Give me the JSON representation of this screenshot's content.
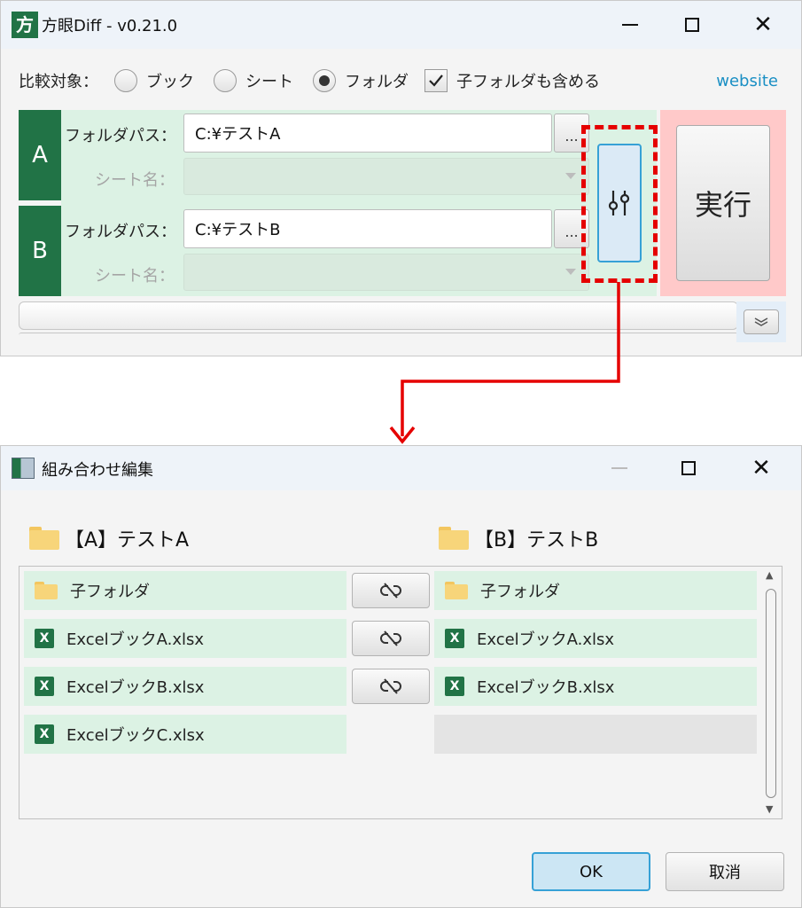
{
  "main_window": {
    "app_icon_glyph": "方",
    "title": "方眼Diff  -  v0.21.0",
    "controls": {
      "minimize": "minimize-icon",
      "maximize": "maximize-icon",
      "close": "close-icon"
    },
    "compare_label": "比較対象：",
    "options": [
      {
        "label": "ブック",
        "selected": false
      },
      {
        "label": "シート",
        "selected": false
      },
      {
        "label": "フォルダ",
        "selected": true
      }
    ],
    "include_subfolders": {
      "label": "子フォルダも含める",
      "checked": true
    },
    "website_link": "website",
    "side_a": {
      "label": "A",
      "folder_label": "フォルダパス：",
      "folder_value": "C:¥テストA",
      "sheet_label": "シート名："
    },
    "side_b": {
      "label": "B",
      "folder_label": "フォルダパス：",
      "folder_value": "C:¥テストB",
      "sheet_label": "シート名："
    },
    "browse_label": "...",
    "run_button": "実行"
  },
  "combination_dialog": {
    "title": "組み合わせ編集",
    "header_a": "【A】テストA",
    "header_b": "【B】テストB",
    "rows_a": [
      {
        "icon": "folder-icon",
        "name": "子フォルダ"
      },
      {
        "icon": "excel-icon",
        "name": "ExcelブックA.xlsx"
      },
      {
        "icon": "excel-icon",
        "name": "ExcelブックB.xlsx"
      },
      {
        "icon": "excel-icon",
        "name": "ExcelブックC.xlsx"
      }
    ],
    "rows_b": [
      {
        "icon": "folder-icon",
        "name": "子フォルダ"
      },
      {
        "icon": "excel-icon",
        "name": "ExcelブックA.xlsx"
      },
      {
        "icon": "excel-icon",
        "name": "ExcelブックB.xlsx"
      }
    ],
    "excel_glyph": "X",
    "ok_button": "OK",
    "cancel_button": "取消"
  },
  "colors": {
    "accent_green": "#217346",
    "panel_green": "#dcf2e4",
    "run_panel_pink": "#ffc9c9",
    "highlight_red": "#e50000",
    "link_blue": "#1a8fc4",
    "focus_blue": "#36a1d6"
  }
}
